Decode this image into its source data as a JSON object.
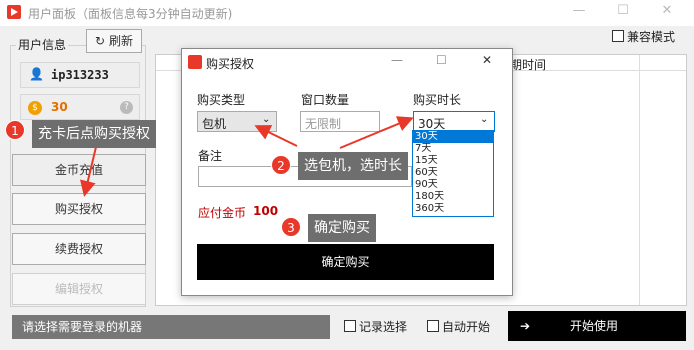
{
  "window": {
    "title": "用户面板（面板信息每3分钟自动更新)",
    "compat_label": "兼容模式"
  },
  "user_panel": {
    "title": "用户信息",
    "refresh": "刷新",
    "username": "ip313233",
    "gold": "30",
    "buttons": [
      "金币充值",
      "购买授权",
      "续费授权",
      "编辑授权"
    ]
  },
  "table": {
    "col_expire": "期时间"
  },
  "status": {
    "hint": "请选择需要登录的机器",
    "record": "记录选择",
    "autostart": "自动开始",
    "start": "开始使用"
  },
  "dialog": {
    "title": "购买授权",
    "type_label": "购买类型",
    "type_value": "包机",
    "count_label": "窗口数量",
    "count_placeholder": "无限制",
    "duration_label": "购买时长",
    "duration_value": "30天",
    "duration_options": [
      "30天",
      "7天",
      "15天",
      "60天",
      "90天",
      "180天",
      "360天"
    ],
    "note_label": "备注",
    "price_label": "应付金币",
    "price_value": "100",
    "confirm": "确定购买"
  },
  "annotations": [
    {
      "n": "1",
      "text": "充卡后点购买授权"
    },
    {
      "n": "2",
      "text": "选包机，选时长"
    },
    {
      "n": "3",
      "text": "确定购买"
    }
  ],
  "colors": {
    "accent": "#e8382a",
    "callout": "#6e6e6e",
    "dropdown_highlight": "#0078d7",
    "price": "#c00000"
  }
}
